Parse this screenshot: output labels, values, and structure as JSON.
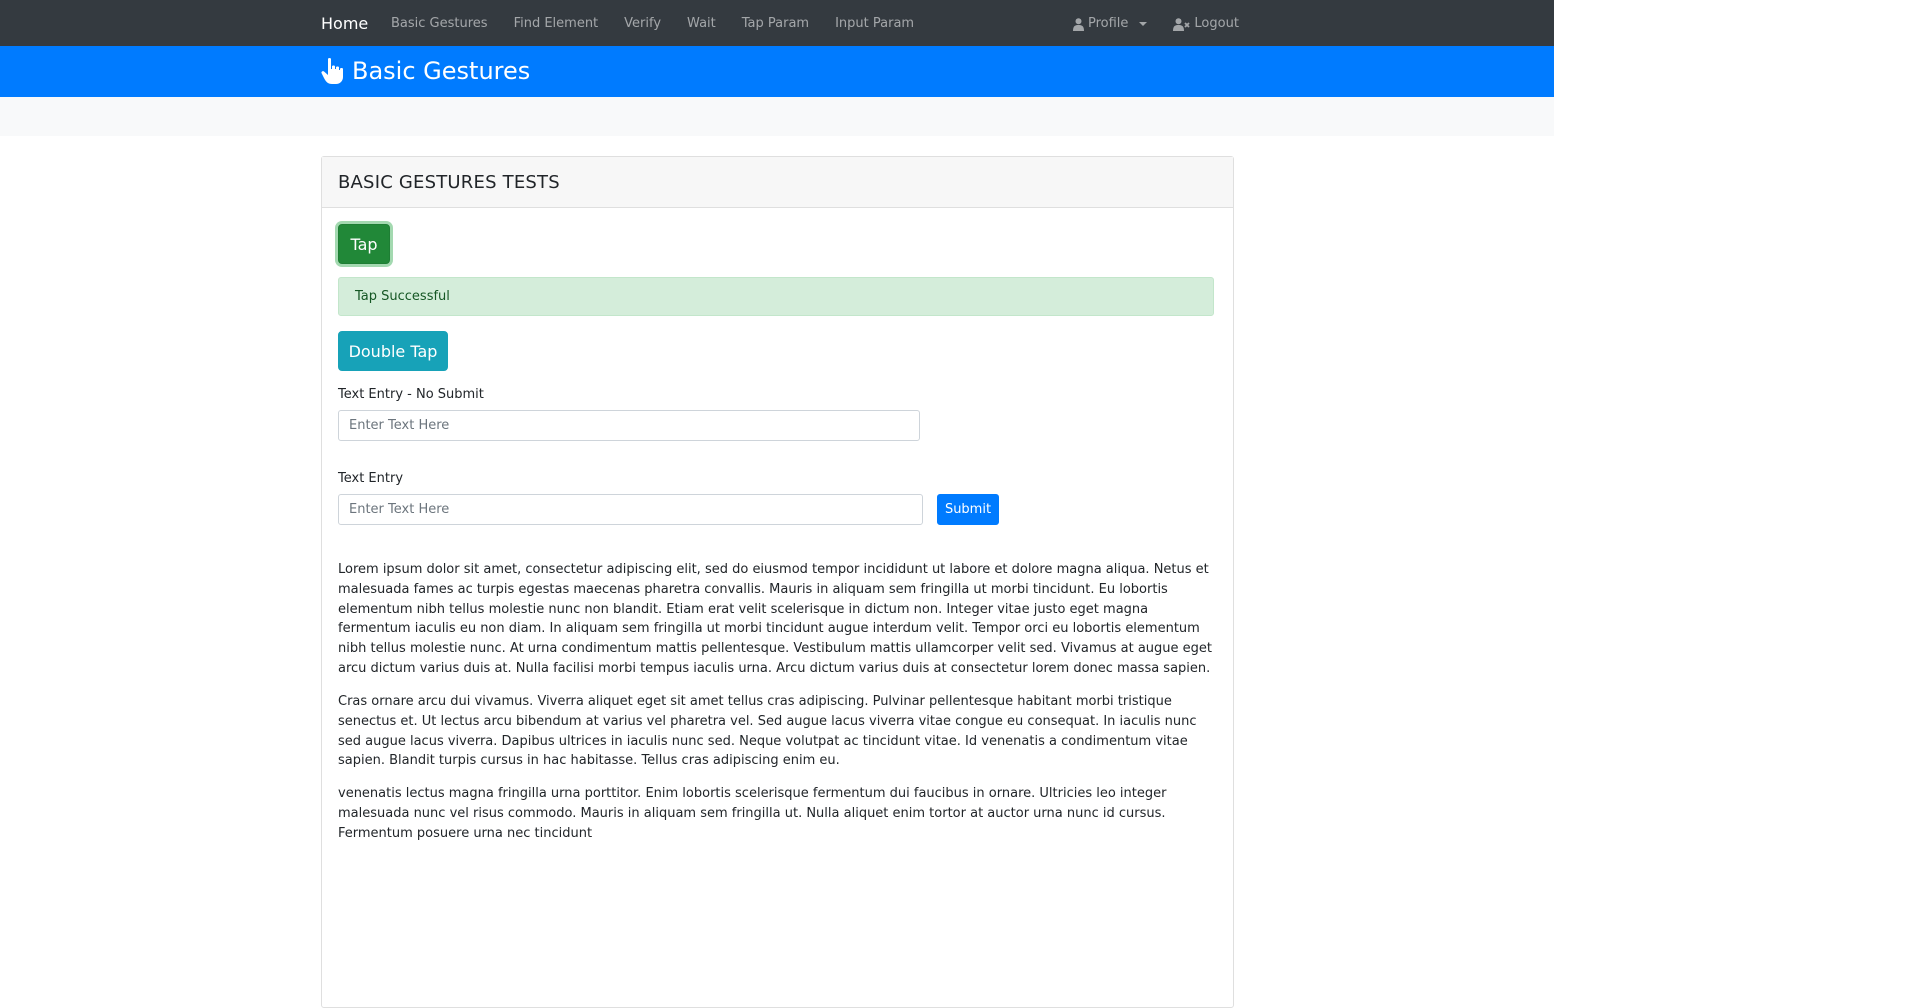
{
  "nav": {
    "brand": "Home",
    "links": [
      "Basic Gestures",
      "Find Element",
      "Verify",
      "Wait",
      "Tap Param",
      "Input Param"
    ],
    "profile": "Profile",
    "logout": "Logout"
  },
  "header": {
    "title": "Basic Gestures",
    "icon": "hand-pointer-icon"
  },
  "card": {
    "title": "BASIC GESTURES TESTS",
    "tap_button": "Tap",
    "alert": "Tap Successful",
    "double_tap_button": "Double Tap",
    "text_entry_no_submit_label": "Text Entry - No Submit",
    "text_entry_no_submit_placeholder": "Enter Text Here",
    "text_entry_label": "Text Entry",
    "text_entry_placeholder": "Enter Text Here",
    "submit_button": "Submit",
    "paragraphs": [
      "Lorem ipsum dolor sit amet, consectetur adipiscing elit, sed do eiusmod tempor incididunt ut labore et dolore magna aliqua. Netus et malesuada fames ac turpis egestas maecenas pharetra convallis. Mauris in aliquam sem fringilla ut morbi tincidunt. Eu lobortis elementum nibh tellus molestie nunc non blandit. Etiam erat velit scelerisque in dictum non. Integer vitae justo eget magna fermentum iaculis eu non diam. In aliquam sem fringilla ut morbi tincidunt augue interdum velit. Tempor orci eu lobortis elementum nibh tellus molestie nunc. At urna condimentum mattis pellentesque. Vestibulum mattis ullamcorper velit sed. Vivamus at augue eget arcu dictum varius duis at. Nulla facilisi morbi tempus iaculis urna. Arcu dictum varius duis at consectetur lorem donec massa sapien.",
      "Cras ornare arcu dui vivamus. Viverra aliquet eget sit amet tellus cras adipiscing. Pulvinar pellentesque habitant morbi tristique senectus et. Ut lectus arcu bibendum at varius vel pharetra vel. Sed augue lacus viverra vitae congue eu consequat. In iaculis nunc sed augue lacus viverra. Dapibus ultrices in iaculis nunc sed. Neque volutpat ac tincidunt vitae. Id venenatis a condimentum vitae sapien. Blandit turpis cursus in hac habitasse. Tellus cras adipiscing enim eu.",
      "venenatis lectus magna fringilla urna porttitor. Enim lobortis scelerisque fermentum dui faucibus in ornare. Ultricies leo integer malesuada nunc vel risus commodo. Mauris in aliquam sem fringilla ut. Nulla aliquet enim tortor at auctor urna nunc id cursus. Fermentum posuere urna nec tincidunt"
    ]
  },
  "colors": {
    "navbar": "#343a40",
    "header": "#007bff",
    "tap_button": "#218838",
    "double_tap_button": "#17a2b8",
    "alert_bg": "#d4edda",
    "submit_button": "#007bff"
  }
}
